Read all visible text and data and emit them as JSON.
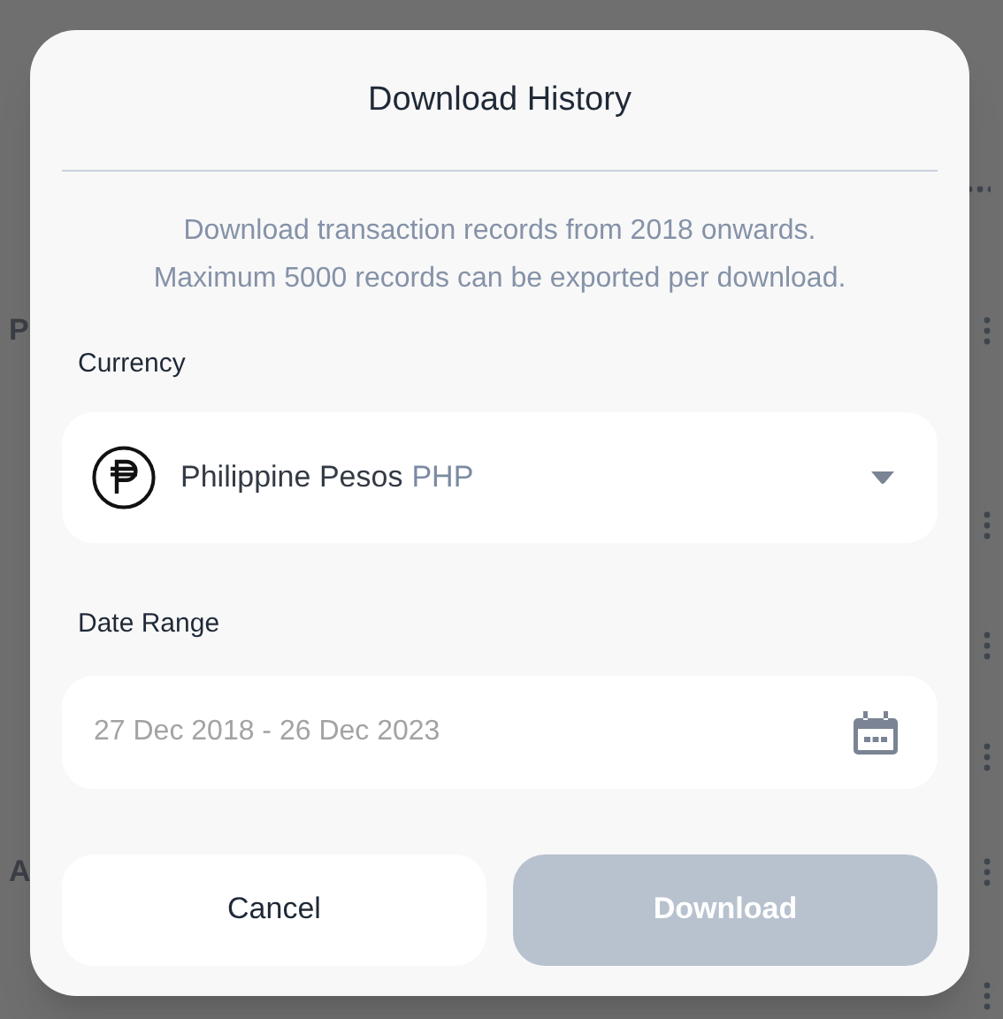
{
  "background": {
    "rows": [
      {
        "kind": "dots"
      },
      {
        "kind": "row",
        "label": "P"
      },
      {
        "kind": "row"
      },
      {
        "kind": "row"
      },
      {
        "kind": "row"
      },
      {
        "kind": "row",
        "label": "A"
      },
      {
        "kind": "row"
      }
    ]
  },
  "dialog": {
    "title": "Download History",
    "description": [
      "Download transaction records from 2018 onwards.",
      "Maximum 5000 records can be exported per download."
    ],
    "currency": {
      "label": "Currency",
      "name": "Philippine Pesos",
      "code": "PHP"
    },
    "date_range": {
      "label": "Date Range",
      "value": "27 Dec 2018 - 26 Dec 2023"
    },
    "buttons": [
      {
        "label": "Cancel",
        "kind": "secondary",
        "disabled": false
      },
      {
        "label": "Download",
        "kind": "primary",
        "disabled": true
      }
    ]
  }
}
